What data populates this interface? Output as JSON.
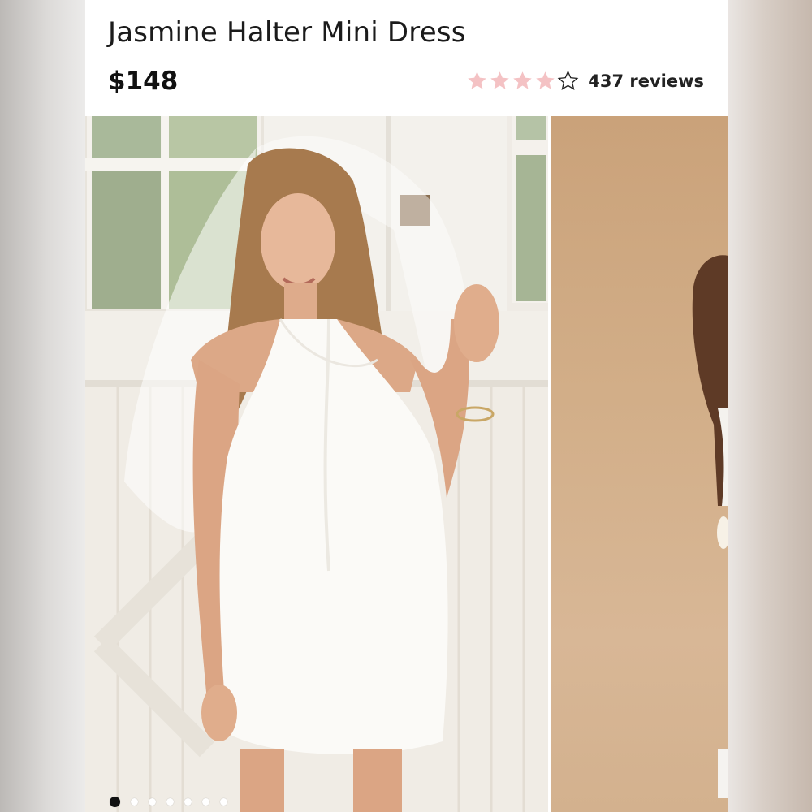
{
  "product": {
    "title": "Jasmine Halter Mini Dress",
    "price": "$148",
    "rating": 4,
    "rating_max": 5,
    "reviews_label": "437 reviews"
  },
  "gallery": {
    "image_count": 7,
    "active_index": 0
  },
  "colors": {
    "star_filled": "#f4c2c4",
    "star_empty_outline": "#f4c2c4",
    "text": "#1b1b1b",
    "second_photo_backdrop": "#d2ae88"
  }
}
